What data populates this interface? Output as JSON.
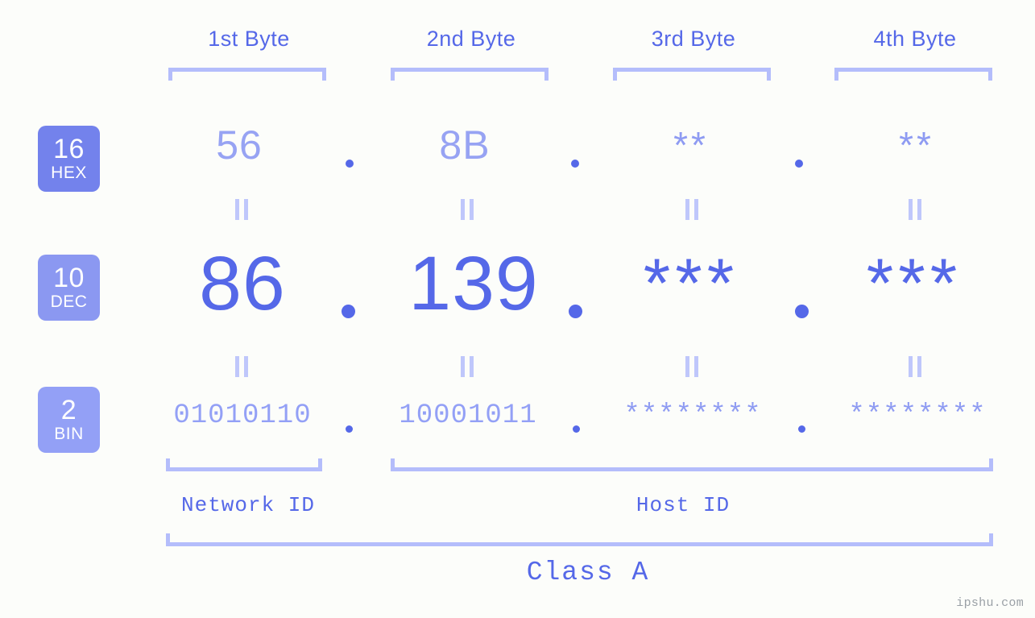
{
  "background_color": "#fcfdfa",
  "accent_colors": {
    "strong_blue": "#5568e8",
    "mid_periwinkle": "#8e9bf2",
    "light_periwinkle": "#b4bdfb",
    "badge_hex": "#7382ec",
    "badge_dec": "#8b98f1",
    "badge_bin": "#93a0f6",
    "watermark_gray": "#9aa0a6"
  },
  "byte_headers": [
    {
      "label": "1st Byte"
    },
    {
      "label": "2nd Byte"
    },
    {
      "label": "3rd Byte"
    },
    {
      "label": "4th Byte"
    }
  ],
  "bases": [
    {
      "number": "16",
      "abbr": "HEX"
    },
    {
      "number": "10",
      "abbr": "DEC"
    },
    {
      "number": "2",
      "abbr": "BIN"
    }
  ],
  "rows": {
    "hex": {
      "values": [
        "56",
        "8B",
        "**",
        "**"
      ]
    },
    "dec": {
      "values": [
        "86",
        "139",
        "***",
        "***"
      ]
    },
    "bin": {
      "values": [
        "01010110",
        "10001011",
        "********",
        "********"
      ]
    }
  },
  "separators": {
    "dot": ".",
    "equals_mark": "="
  },
  "sections": [
    {
      "label": "Network ID"
    },
    {
      "label": "Host ID"
    }
  ],
  "class": {
    "label": "Class A"
  },
  "watermark": {
    "text": "ipshu.com"
  },
  "chart_data": {
    "type": "table",
    "title": "IP address byte decomposition",
    "columns": [
      "1st Byte",
      "2nd Byte",
      "3rd Byte",
      "4th Byte"
    ],
    "rows": [
      {
        "base": "16",
        "base_name": "HEX",
        "cells": [
          "56",
          "8B",
          "**",
          "**"
        ]
      },
      {
        "base": "10",
        "base_name": "DEC",
        "cells": [
          "86",
          "139",
          "***",
          "***"
        ]
      },
      {
        "base": "2",
        "base_name": "BIN",
        "cells": [
          "01010110",
          "10001011",
          "********",
          "********"
        ]
      }
    ],
    "network_id_span": [
      "1st Byte"
    ],
    "host_id_span": [
      "2nd Byte",
      "3rd Byte",
      "4th Byte"
    ],
    "address_class": "Class A"
  }
}
